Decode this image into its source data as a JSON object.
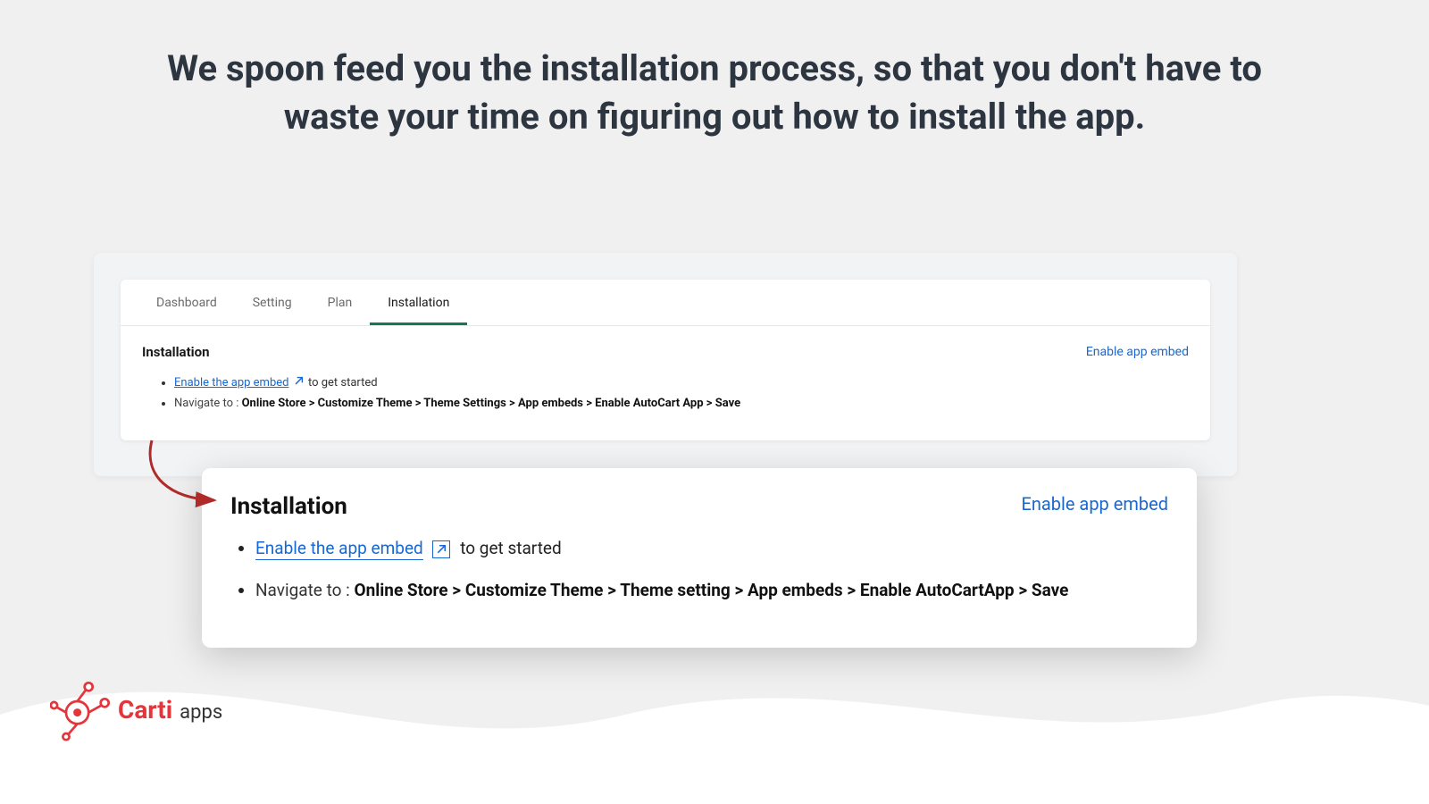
{
  "headline": "We spoon feed you the installation process, so that you don't have to waste your time on figuring out how to install the app.",
  "app": {
    "tabs": [
      {
        "label": "Dashboard",
        "active": false
      },
      {
        "label": "Setting",
        "active": false
      },
      {
        "label": "Plan",
        "active": false
      },
      {
        "label": "Installation",
        "active": true
      }
    ],
    "section_title": "Installation",
    "enable_link": "Enable app embed",
    "bullet1_link": "Enable the app embed",
    "bullet1_suffix": " to get started",
    "bullet2_prefix": "Navigate to : ",
    "bullet2_path": "Online Store > Customize Theme > Theme Settings > App embeds > Enable AutoCart App > Save"
  },
  "zoom": {
    "title": "Installation",
    "enable_link": "Enable app embed",
    "bullet1_link": "Enable the app embed",
    "bullet1_suffix": " to get started",
    "bullet2_prefix": "Navigate to : ",
    "bullet2_path": "Online Store > Customize Theme > Theme setting > App embeds > Enable AutoCartApp > Save"
  },
  "logo": {
    "brand": "Carti",
    "suffix": "apps"
  },
  "colors": {
    "accent_green": "#0f7a5a",
    "link_blue": "#1968d2",
    "brand_red": "#e4353a",
    "text_dark": "#2c3540"
  }
}
